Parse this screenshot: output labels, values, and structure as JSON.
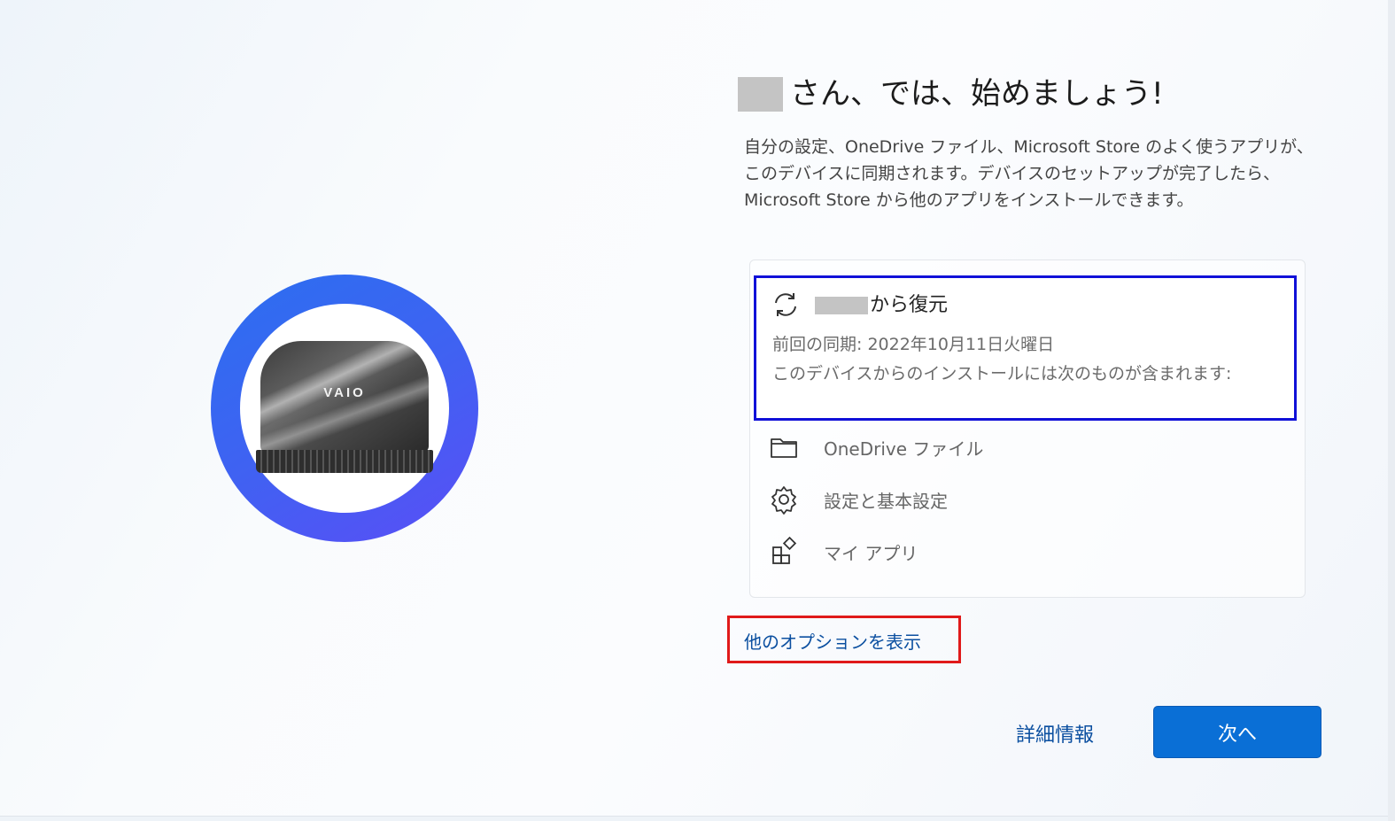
{
  "heading": {
    "title": "さん、では、始めましょう!"
  },
  "description": "自分の設定、OneDrive ファイル、Microsoft Store のよく使うアプリが、このデバイスに同期されます。デバイスのセットアップが完了したら、Microsoft Store から他のアプリをインストールできます。",
  "restore": {
    "title": "から復元",
    "last_sync": "前回の同期: 2022年10月11日火曜日",
    "includes": "このデバイスからのインストールには次のものが含まれます:",
    "items": [
      {
        "label": "OneDrive ファイル",
        "icon": "folder-icon"
      },
      {
        "label": "設定と基本設定",
        "icon": "gear-icon"
      },
      {
        "label": "マイ アプリ",
        "icon": "apps-icon"
      }
    ]
  },
  "links": {
    "more_options": "他のオプションを表示",
    "details": "詳細情報"
  },
  "buttons": {
    "next": "次へ"
  },
  "device": {
    "brand": "VAIO"
  },
  "colors": {
    "accent": "#0a6fd6",
    "link": "#0b4fa0",
    "highlight_blue": "#1010d8",
    "highlight_red": "#e01a1a"
  }
}
